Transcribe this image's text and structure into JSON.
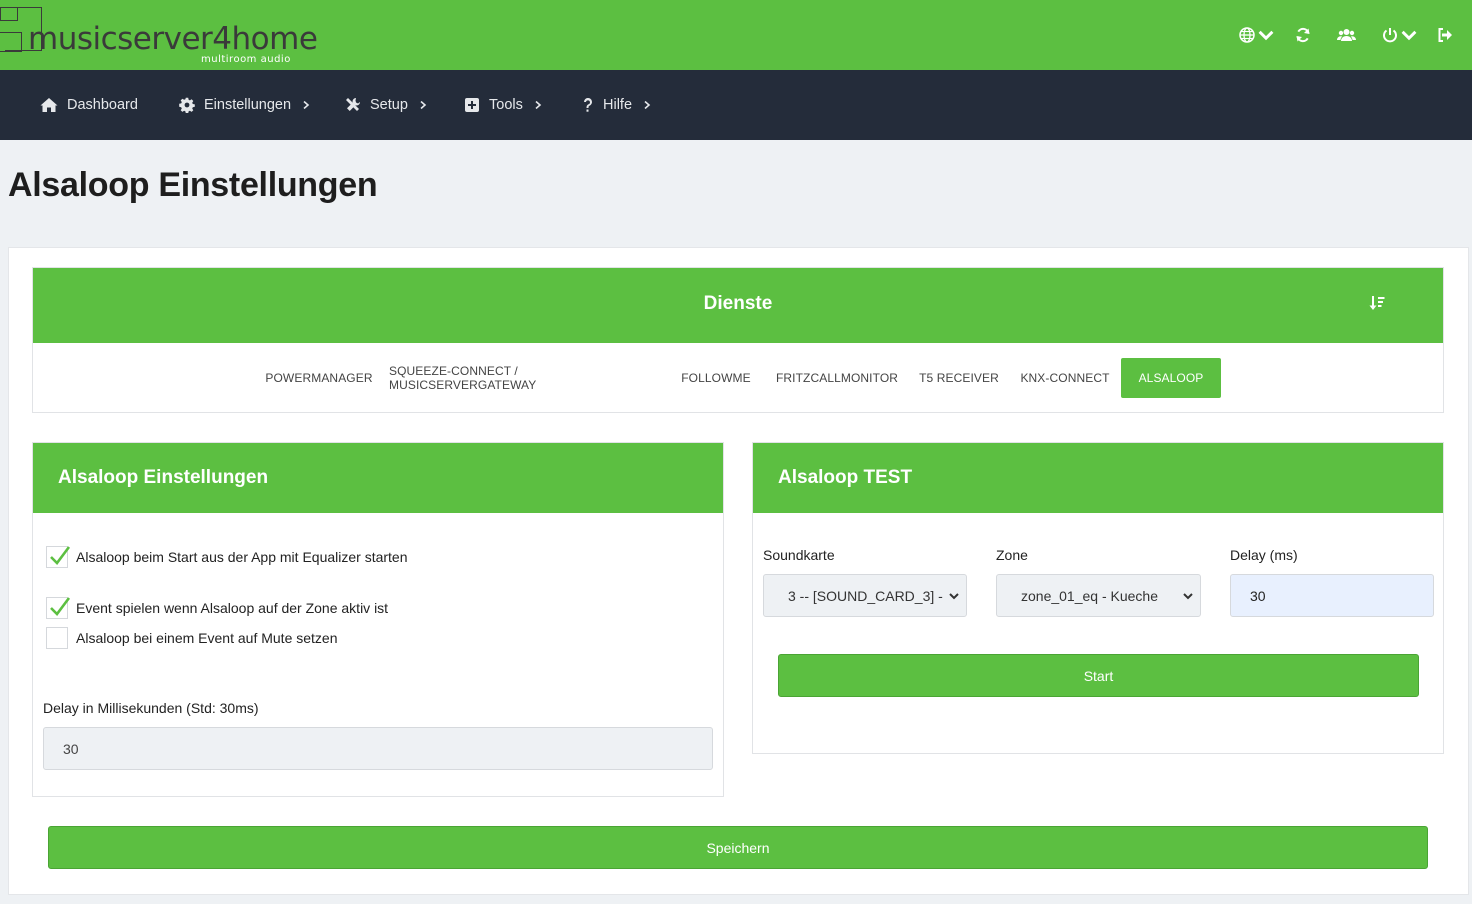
{
  "brand": {
    "name": "musicserver4home",
    "tagline": "multiroom audio"
  },
  "top_icons": [
    "globe-icon",
    "refresh-icon",
    "users-icon",
    "power-icon",
    "sign-out-icon"
  ],
  "nav": {
    "items": [
      {
        "label": "Dashboard",
        "icon": "home-icon"
      },
      {
        "label": "Einstellungen",
        "icon": "gear-icon"
      },
      {
        "label": "Setup",
        "icon": "tools-icon"
      },
      {
        "label": "Tools",
        "icon": "plus-square-icon"
      },
      {
        "label": "Hilfe",
        "icon": "question-icon"
      }
    ]
  },
  "page_title": "Alsaloop Einstellungen",
  "dienste": {
    "title": "Dienste",
    "tabs": [
      {
        "label": "POWERMANAGER",
        "active": false
      },
      {
        "label": "SQUEEZE-CONNECT / MUSICSERVERGATEWAY",
        "active": false
      },
      {
        "label": "FOLLOWME",
        "active": false
      },
      {
        "label": "FRITZCALLMONITOR",
        "active": false
      },
      {
        "label": "T5 RECEIVER",
        "active": false
      },
      {
        "label": "KNX-CONNECT",
        "active": false
      },
      {
        "label": "ALSALOOP",
        "active": true
      }
    ]
  },
  "settings": {
    "title": "Alsaloop Einstellungen",
    "checkboxes": [
      {
        "label": "Alsaloop beim Start aus der App mit Equalizer starten",
        "checked": true
      },
      {
        "label": "Event spielen wenn Alsaloop auf der Zone aktiv ist",
        "checked": true
      },
      {
        "label": "Alsaloop bei einem Event auf Mute setzen",
        "checked": false
      }
    ],
    "delay_label": "Delay in Millisekunden (Std: 30ms)",
    "delay_value": "30"
  },
  "test": {
    "title": "Alsaloop TEST",
    "soundcard_label": "Soundkarte",
    "soundcard_value": "3 -- [SOUND_CARD_3] -",
    "zone_label": "Zone",
    "zone_value": "zone_01_eq - Kueche",
    "delay_label": "Delay (ms)",
    "delay_value": "30",
    "start_label": "Start"
  },
  "save_label": "Speichern",
  "colors": {
    "accent": "#5cbf41",
    "nav_bg": "#242c3a",
    "page_bg": "#eef1f4"
  }
}
